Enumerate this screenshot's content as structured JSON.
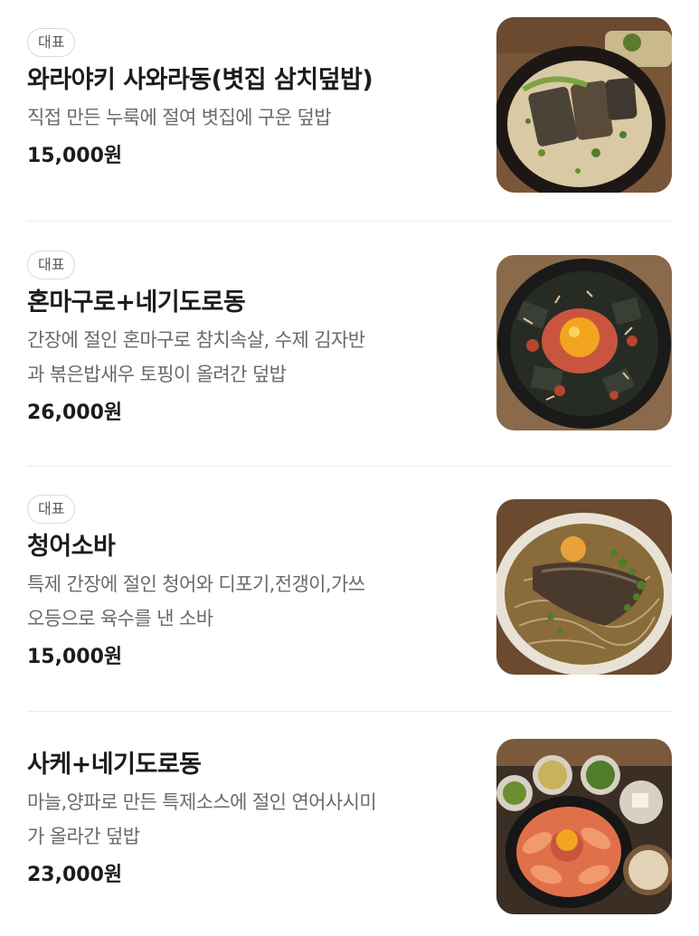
{
  "menu": {
    "items": [
      {
        "badge": "대표",
        "name": "와라야키 사와라동(볏집 삼치덮밥)",
        "desc_lines": [
          "직접 만든 누룩에 절여 볏집에 구운 덮밥"
        ],
        "price": "15,000원",
        "image_icon": "mackerel-rice-bowl-photo"
      },
      {
        "badge": "대표",
        "name": "혼마구로+네기도로동",
        "desc_lines": [
          "간장에 절인 혼마구로 참치속살, 수제 김자반",
          "과 볶은밥새우 토핑이 올려간 덮밥"
        ],
        "price": "26,000원",
        "image_icon": "tuna-rice-bowl-photo"
      },
      {
        "badge": "대표",
        "name": "청어소바",
        "desc_lines": [
          "특제 간장에 절인 청어와 디포기,전갱이,가쓰",
          "오등으로 육수를 낸 소바"
        ],
        "price": "15,000원",
        "image_icon": "herring-soba-photo"
      },
      {
        "badge": "",
        "name": "사케+네기도로동",
        "desc_lines": [
          "마늘,양파로 만든 특제소스에 절인 연어사시미",
          "가 올라간 덮밥"
        ],
        "price": "23,000원",
        "image_icon": "salmon-rice-set-photo"
      }
    ]
  }
}
